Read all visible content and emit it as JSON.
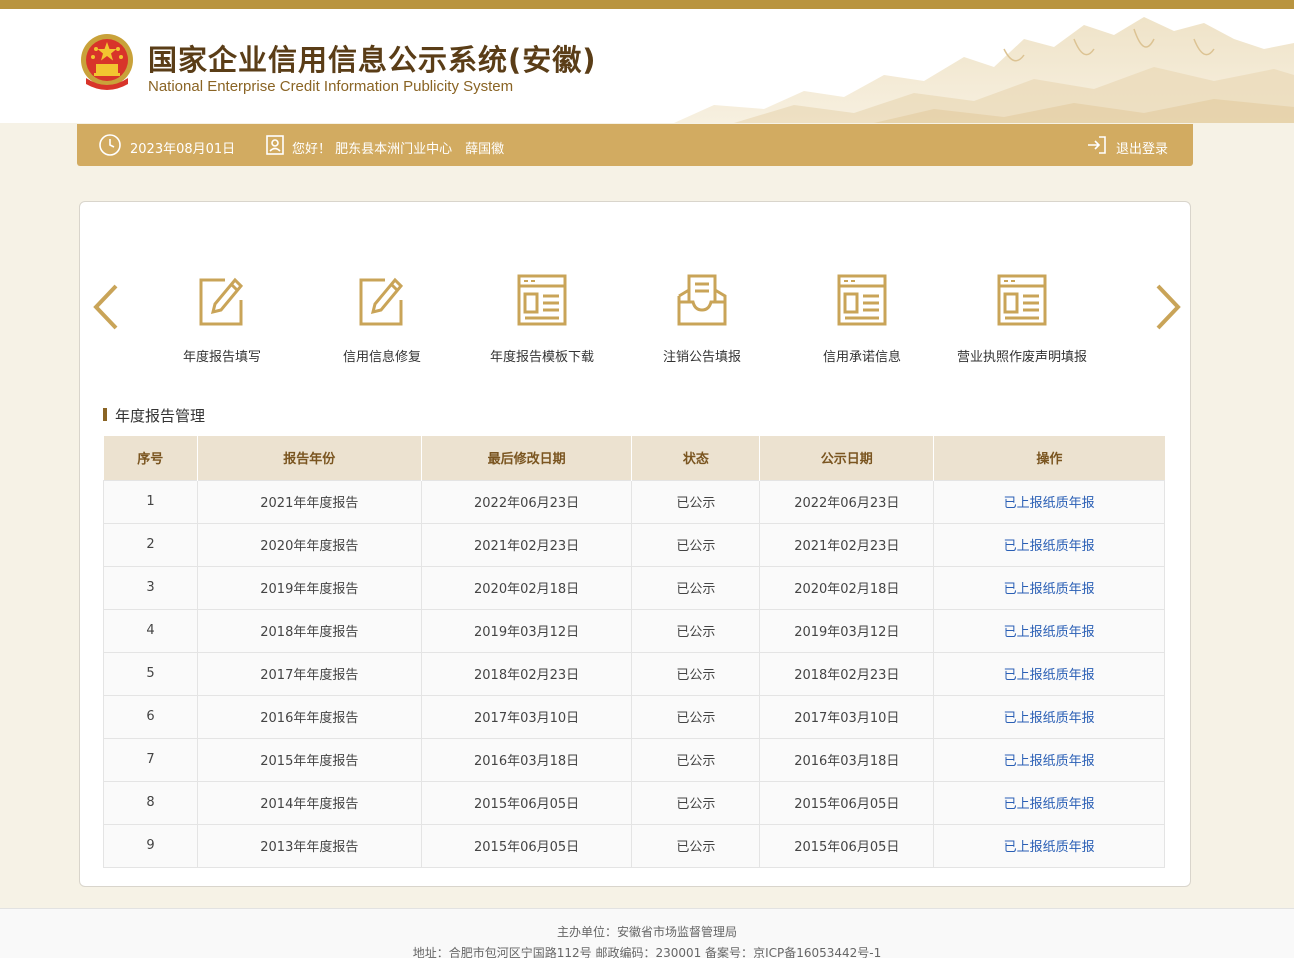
{
  "header": {
    "title_cn": "国家企业信用信息公示系统(安徽)",
    "title_en": "National Enterprise Credit Information Publicity System"
  },
  "infobar": {
    "date": "2023年08月01日",
    "greeting": "您好！ 肥东县本洲门业中心　薛国徽",
    "logout": "退出登录"
  },
  "functions": [
    {
      "label": "年度报告填写",
      "icon": "pencil-edit-icon"
    },
    {
      "label": "信用信息修复",
      "icon": "pencil-edit-icon"
    },
    {
      "label": "年度报告模板下载",
      "icon": "document-window-icon"
    },
    {
      "label": "注销公告填报",
      "icon": "inbox-tray-icon"
    },
    {
      "label": "信用承诺信息",
      "icon": "document-window-icon"
    },
    {
      "label": "营业执照作废声明填报",
      "icon": "document-window-icon"
    }
  ],
  "section": {
    "title": "年度报告管理"
  },
  "table": {
    "headers": [
      "序号",
      "报告年份",
      "最后修改日期",
      "状态",
      "公示日期",
      "操作"
    ],
    "rows": [
      [
        "1",
        "2021年年度报告",
        "2022年06月23日",
        "已公示",
        "2022年06月23日",
        "已上报纸质年报"
      ],
      [
        "2",
        "2020年年度报告",
        "2021年02月23日",
        "已公示",
        "2021年02月23日",
        "已上报纸质年报"
      ],
      [
        "3",
        "2019年年度报告",
        "2020年02月18日",
        "已公示",
        "2020年02月18日",
        "已上报纸质年报"
      ],
      [
        "4",
        "2018年年度报告",
        "2019年03月12日",
        "已公示",
        "2019年03月12日",
        "已上报纸质年报"
      ],
      [
        "5",
        "2017年年度报告",
        "2018年02月23日",
        "已公示",
        "2018年02月23日",
        "已上报纸质年报"
      ],
      [
        "6",
        "2016年年度报告",
        "2017年03月10日",
        "已公示",
        "2017年03月10日",
        "已上报纸质年报"
      ],
      [
        "7",
        "2015年年度报告",
        "2016年03月18日",
        "已公示",
        "2016年03月18日",
        "已上报纸质年报"
      ],
      [
        "8",
        "2014年年度报告",
        "2015年06月05日",
        "已公示",
        "2015年06月05日",
        "已上报纸质年报"
      ],
      [
        "9",
        "2013年年度报告",
        "2015年06月05日",
        "已公示",
        "2015年06月05日",
        "已上报纸质年报"
      ]
    ]
  },
  "footer": {
    "line1": "主办单位：安徽省市场监督管理局",
    "line2": "地址：合肥市包河区宁国路112号 邮政编码：230001 备案号：京ICP备16053442号-1"
  },
  "colors": {
    "brand_gold": "#d2ab61",
    "title_brown": "#5a3d17",
    "link_blue": "#2a5fb5"
  }
}
